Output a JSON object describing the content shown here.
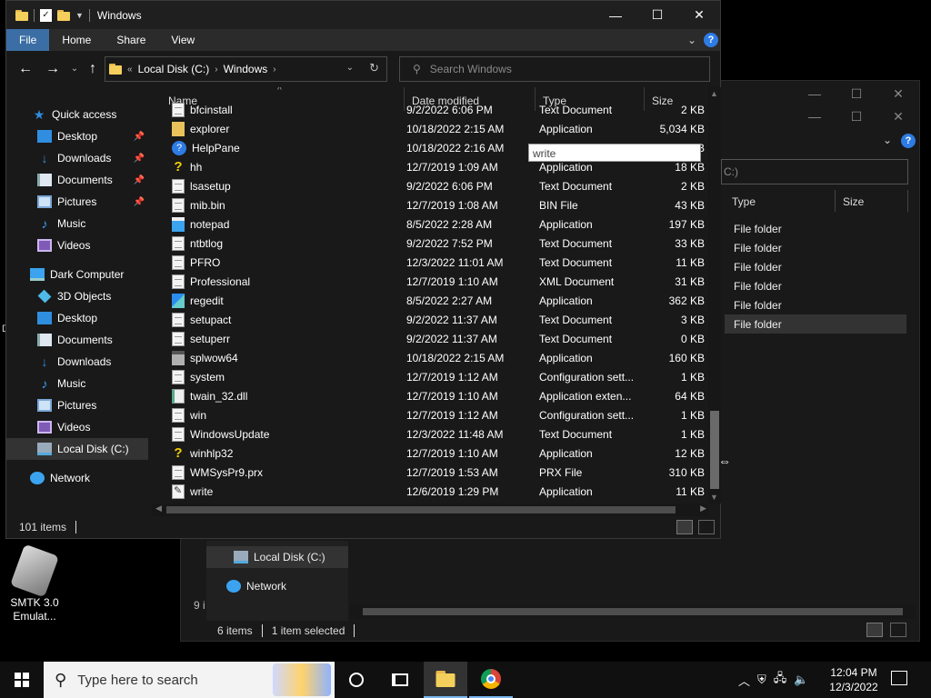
{
  "window": {
    "title": "Windows",
    "controls": {
      "minimize": "—",
      "maximize": "☐",
      "close": "✕"
    }
  },
  "ribbon": {
    "tabs": [
      "File",
      "Home",
      "Share",
      "View"
    ]
  },
  "address": {
    "overflow": "«",
    "crumbs": [
      "Local Disk (C:)",
      "Windows"
    ],
    "search_placeholder": "Search Windows"
  },
  "nav": {
    "items": [
      {
        "label": "Quick access",
        "icon": "star-icon",
        "pinned": false
      },
      {
        "label": "Desktop",
        "icon": "desktop-folder-icon",
        "pinned": true
      },
      {
        "label": "Downloads",
        "icon": "downloads-icon",
        "pinned": true
      },
      {
        "label": "Documents",
        "icon": "documents-icon",
        "pinned": true
      },
      {
        "label": "Pictures",
        "icon": "pictures-icon",
        "pinned": true
      },
      {
        "label": "Music",
        "icon": "music-icon",
        "pinned": false
      },
      {
        "label": "Videos",
        "icon": "videos-icon",
        "pinned": false
      },
      {
        "label": "Dark Computer",
        "icon": "this-pc-icon",
        "pinned": false
      },
      {
        "label": "3D Objects",
        "icon": "3d-objects-icon",
        "pinned": false
      },
      {
        "label": "Desktop",
        "icon": "desktop-folder-icon",
        "pinned": false
      },
      {
        "label": "Documents",
        "icon": "documents-icon",
        "pinned": false
      },
      {
        "label": "Downloads",
        "icon": "downloads-icon",
        "pinned": false
      },
      {
        "label": "Music",
        "icon": "music-icon",
        "pinned": false
      },
      {
        "label": "Pictures",
        "icon": "pictures-icon",
        "pinned": false
      },
      {
        "label": "Videos",
        "icon": "videos-icon",
        "pinned": false
      },
      {
        "label": "Local Disk (C:)",
        "icon": "local-disk-icon",
        "pinned": false,
        "selected": true
      },
      {
        "label": "Network",
        "icon": "network-icon",
        "pinned": false
      }
    ]
  },
  "columns": [
    "Name",
    "Date modified",
    "Type",
    "Size"
  ],
  "files": [
    {
      "name": "bfcinstall",
      "date": "9/2/2022 6:06 PM",
      "type": "Text Document",
      "size": "2 KB",
      "icon": "text-document-icon"
    },
    {
      "name": "explorer",
      "date": "10/18/2022 2:15 AM",
      "type": "Application",
      "size": "5,034 KB",
      "icon": "explorer-app-icon"
    },
    {
      "name": "HelpPane",
      "date": "10/18/2022 2:16 AM",
      "type": "",
      "size": "KB",
      "icon": "help-pane-icon"
    },
    {
      "name": "hh",
      "date": "12/7/2019 1:09 AM",
      "type": "Application",
      "size": "18 KB",
      "icon": "help-app-icon"
    },
    {
      "name": "lsasetup",
      "date": "9/2/2022 6:06 PM",
      "type": "Text Document",
      "size": "2 KB",
      "icon": "text-document-icon"
    },
    {
      "name": "mib.bin",
      "date": "12/7/2019 1:08 AM",
      "type": "BIN File",
      "size": "43 KB",
      "icon": "bin-file-icon"
    },
    {
      "name": "notepad",
      "date": "8/5/2022 2:28 AM",
      "type": "Application",
      "size": "197 KB",
      "icon": "notepad-icon"
    },
    {
      "name": "ntbtlog",
      "date": "9/2/2022 7:52 PM",
      "type": "Text Document",
      "size": "33 KB",
      "icon": "text-document-icon"
    },
    {
      "name": "PFRO",
      "date": "12/3/2022 11:01 AM",
      "type": "Text Document",
      "size": "11 KB",
      "icon": "text-document-icon"
    },
    {
      "name": "Professional",
      "date": "12/7/2019 1:10 AM",
      "type": "XML Document",
      "size": "31 KB",
      "icon": "xml-document-icon"
    },
    {
      "name": "regedit",
      "date": "8/5/2022 2:27 AM",
      "type": "Application",
      "size": "362 KB",
      "icon": "regedit-icon"
    },
    {
      "name": "setupact",
      "date": "9/2/2022 11:37 AM",
      "type": "Text Document",
      "size": "3 KB",
      "icon": "text-document-icon"
    },
    {
      "name": "setuperr",
      "date": "9/2/2022 11:37 AM",
      "type": "Text Document",
      "size": "0 KB",
      "icon": "text-document-icon"
    },
    {
      "name": "splwow64",
      "date": "10/18/2022 2:15 AM",
      "type": "Application",
      "size": "160 KB",
      "icon": "printer-app-icon"
    },
    {
      "name": "system",
      "date": "12/7/2019 1:12 AM",
      "type": "Configuration sett...",
      "size": "1 KB",
      "icon": "config-file-icon"
    },
    {
      "name": "twain_32.dll",
      "date": "12/7/2019 1:10 AM",
      "type": "Application exten...",
      "size": "64 KB",
      "icon": "dll-file-icon"
    },
    {
      "name": "win",
      "date": "12/7/2019 1:12 AM",
      "type": "Configuration sett...",
      "size": "1 KB",
      "icon": "config-file-icon"
    },
    {
      "name": "WindowsUpdate",
      "date": "12/3/2022 11:48 AM",
      "type": "Text Document",
      "size": "1 KB",
      "icon": "text-document-icon"
    },
    {
      "name": "winhlp32",
      "date": "12/7/2019 1:10 AM",
      "type": "Application",
      "size": "12 KB",
      "icon": "help-app-icon"
    },
    {
      "name": "WMSysPr9.prx",
      "date": "12/7/2019 1:53 AM",
      "type": "PRX File",
      "size": "310 KB",
      "icon": "prx-file-icon"
    },
    {
      "name": "write",
      "date": "12/6/2019 1:29 PM",
      "type": "Application",
      "size": "11 KB",
      "icon": "write-app-icon"
    }
  ],
  "tooltip": "write",
  "status": {
    "count": "101 items"
  },
  "background_window": {
    "search_text": "C:)",
    "columns": [
      "Type",
      "Size"
    ],
    "types": [
      "File folder",
      "File folder",
      "File folder",
      "File folder",
      "File folder",
      "File folder"
    ],
    "nav": [
      "Local Disk (C:)",
      "Network"
    ],
    "partial_count": "9 i",
    "status_count": "6 items",
    "status_selected": "1 item selected"
  },
  "desktop": {
    "icon_label": "SMTK 3.0 Emulat...",
    "edge_letter": "D"
  },
  "taskbar": {
    "search_placeholder": "Type here to search",
    "time": "12:04 PM",
    "date": "12/3/2022"
  }
}
